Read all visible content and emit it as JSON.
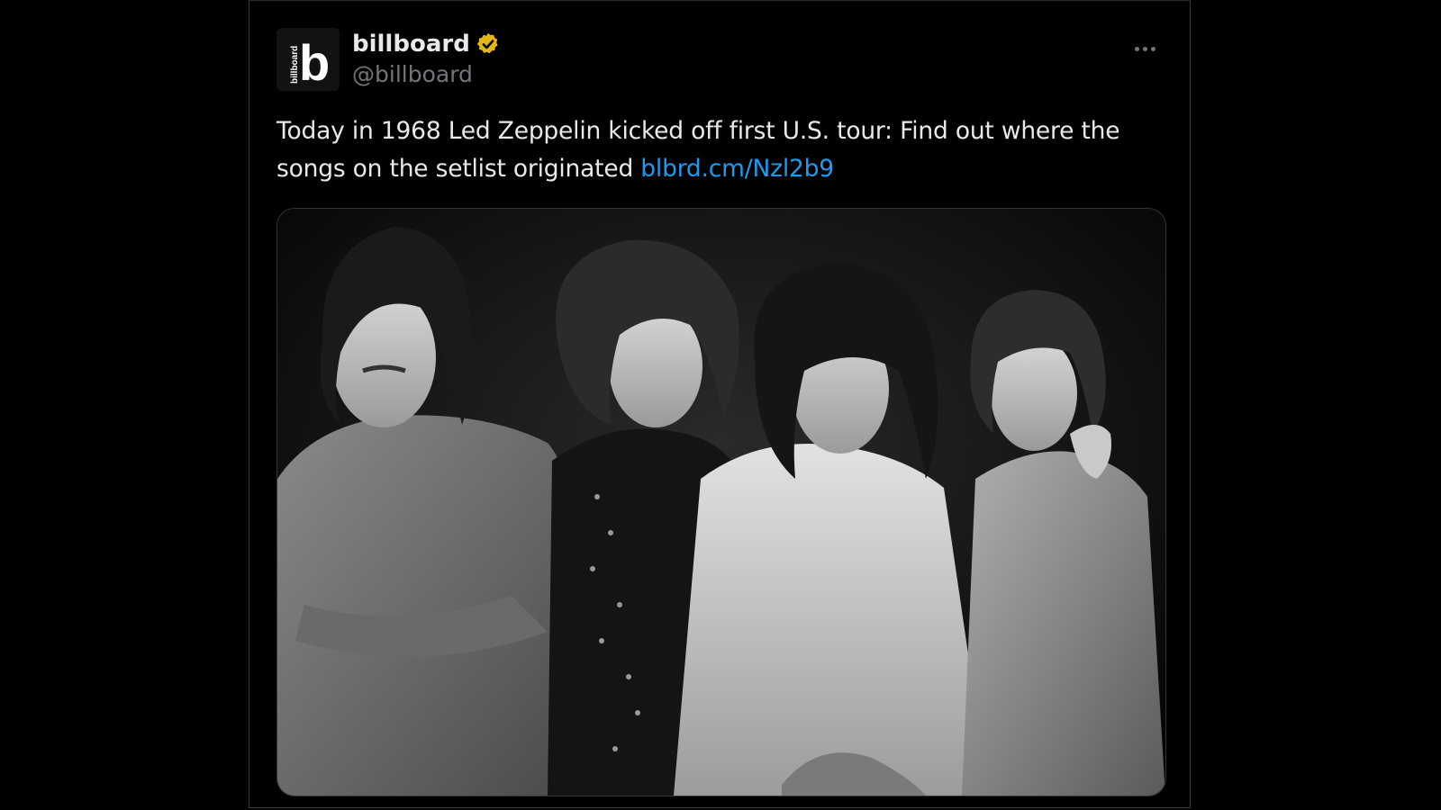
{
  "tweet": {
    "author": {
      "display_name": "billboard",
      "handle": "@billboard",
      "verified": true,
      "avatar_logo_text": "billboard",
      "avatar_letter": "b"
    },
    "text": "Today in 1968 Led Zeppelin kicked off first U.S. tour: Find out where the songs on the setlist originated",
    "link_text": "blbrd.cm/Nzl2b9",
    "media": {
      "kind": "black-and-white band photo",
      "alt": ""
    }
  },
  "colors": {
    "background": "#000000",
    "text_primary": "#e7e9ea",
    "text_secondary": "#71767b",
    "link": "#1d9bf0",
    "verified_badge": "#e2b719"
  },
  "icons": {
    "verified": "verified-badge-icon",
    "more": "more-options-icon"
  }
}
